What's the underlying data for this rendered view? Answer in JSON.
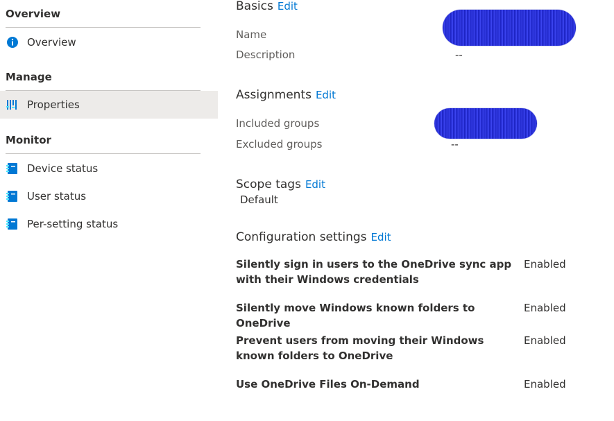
{
  "sidebar": {
    "sections": [
      {
        "heading": "Overview",
        "items": [
          {
            "label": "Overview",
            "icon": "info-icon"
          }
        ]
      },
      {
        "heading": "Manage",
        "items": [
          {
            "label": "Properties",
            "icon": "properties-icon",
            "active": true
          }
        ]
      },
      {
        "heading": "Monitor",
        "items": [
          {
            "label": "Device status",
            "icon": "report-icon"
          },
          {
            "label": "User status",
            "icon": "report-icon"
          },
          {
            "label": "Per-setting status",
            "icon": "report-icon"
          }
        ]
      }
    ]
  },
  "main": {
    "edit_label": "Edit",
    "basics": {
      "title": "Basics",
      "name_label": "Name",
      "description_label": "Description",
      "description_value": "--"
    },
    "assignments": {
      "title": "Assignments",
      "included_label": "Included groups",
      "excluded_label": "Excluded groups",
      "excluded_value": "--"
    },
    "scope_tags": {
      "title": "Scope tags",
      "value": "Default"
    },
    "configuration": {
      "title": "Configuration settings",
      "settings": [
        {
          "name": "Silently sign in users to the OneDrive sync app with their Windows credentials",
          "value": "Enabled"
        },
        {
          "name": "Silently move Windows known folders to OneDrive",
          "value": "Enabled"
        },
        {
          "name": "Prevent users from moving their Windows known folders to OneDrive",
          "value": "Enabled"
        },
        {
          "name": "Use OneDrive Files On-Demand",
          "value": "Enabled"
        }
      ]
    }
  },
  "colors": {
    "accent": "#0078d4",
    "active_bg": "#edebe9",
    "redaction": "#2a32d8"
  }
}
